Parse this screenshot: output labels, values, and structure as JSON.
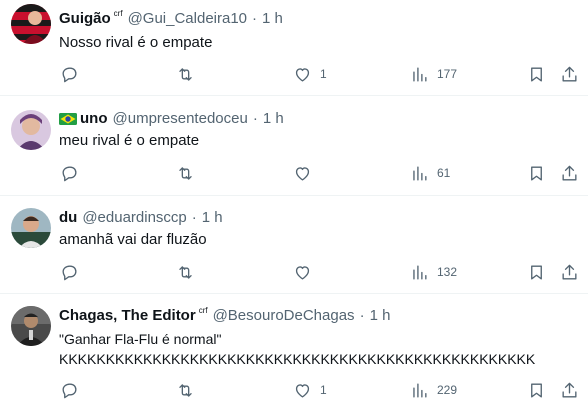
{
  "tweets": [
    {
      "name": "Guigão",
      "badge": "crf",
      "handle": "@Gui_Caldeira10",
      "dot": "·",
      "time": "1 h",
      "text": "Nosso rival é o empate",
      "replies": "",
      "retweets": "",
      "likes": "1",
      "views": "177",
      "avatar_colors": [
        "#c8102e",
        "#1a1a1a"
      ]
    },
    {
      "name": "uno",
      "flag": "brazil-flag-icon",
      "badge": "",
      "handle": "@umpresentedoceu",
      "dot": "·",
      "time": "1 h",
      "text": "meu rival é o empate",
      "replies": "",
      "retweets": "",
      "likes": "",
      "views": "61",
      "avatar_colors": [
        "#b78db8",
        "#5b3a6e"
      ]
    },
    {
      "name": "du",
      "badge": "",
      "handle": "@eduardinsccp",
      "dot": "·",
      "time": "1 h",
      "text": "amanhã vai dar fluzão",
      "replies": "",
      "retweets": "",
      "likes": "",
      "views": "132",
      "avatar_colors": [
        "#6e8f9e",
        "#2b4a3a"
      ]
    },
    {
      "name": "Chagas, The Editor",
      "badge": "crf",
      "handle": "@BesouroDeChagas",
      "dot": "·",
      "time": "1 h",
      "text": "\"Ganhar Fla-Flu é normal\"\nKKKKKKKKKKKKKKKKKKKKKKKKKKKKKKKKKKKKKKKKKKKKKKKKKKK",
      "replies": "",
      "retweets": "",
      "likes": "1",
      "views": "229",
      "avatar_colors": [
        "#3a3a3a",
        "#8a6f55"
      ]
    }
  ],
  "icons": {
    "reply": "reply-icon",
    "retweet": "retweet-icon",
    "like": "heart-icon",
    "views": "views-icon",
    "bookmark": "bookmark-icon",
    "share": "share-icon"
  },
  "colors": {
    "text": "#0f1419",
    "secondary": "#536471",
    "divider": "#eff3f4"
  }
}
